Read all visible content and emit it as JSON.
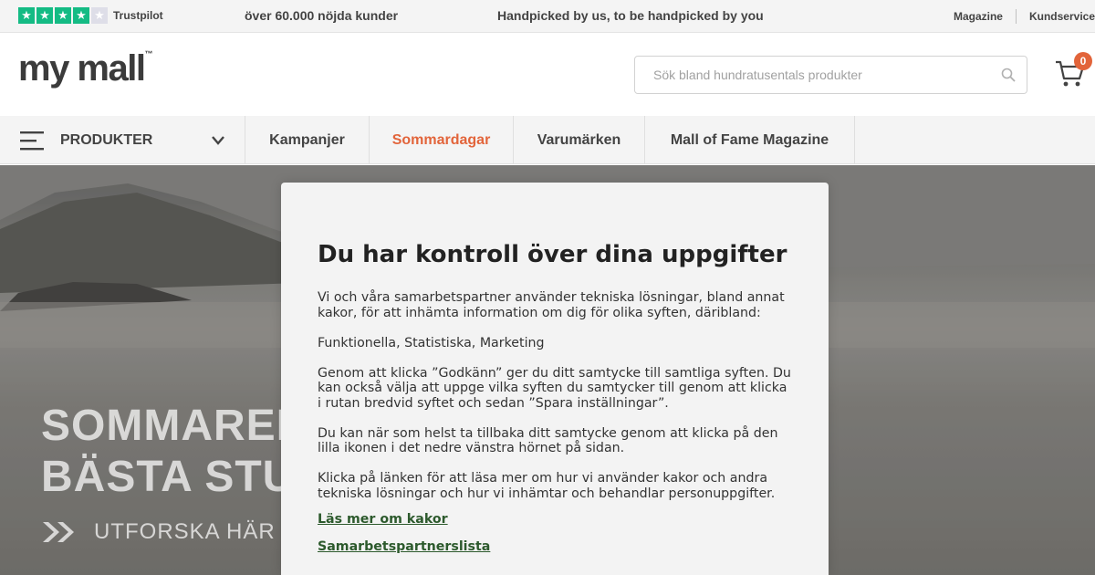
{
  "topbar": {
    "trustpilot_label": "Trustpilot",
    "trustpilot_stars": 4,
    "trustpilot_max": 5,
    "happy_customers": "över 60.000 nöjda kunder",
    "slogan": "Handpicked by us, to be handpicked by you",
    "links": [
      "Magazine",
      "Kundservice"
    ]
  },
  "header": {
    "logo": "my mall",
    "logo_tm": "™",
    "search_placeholder": "Sök bland hundratusentals produkter",
    "cart_count": "0"
  },
  "nav": {
    "products_label": "PRODUKTER",
    "items": [
      "Kampanjer",
      "Sommardagar",
      "Varumärken",
      "Mall of Fame Magazine"
    ],
    "highlight_color": "#e0572a"
  },
  "hero": {
    "title_line1": "SOMMAREN",
    "title_line2": "BÄSTA STU",
    "cta": "UTFORSKA HÄR"
  },
  "consent": {
    "title": "Du har kontroll över dina uppgifter",
    "p1": "Vi och våra samarbetspartner använder tekniska lösningar, bland annat kakor, för att inhämta information om dig för olika syften, däribland:",
    "p2": "Funktionella, Statistiska, Marketing",
    "p3": "Genom att klicka ”Godkänn” ger du ditt samtycke till samtliga syften. Du kan också välja att uppge vilka syften du samtycker till genom att klicka i rutan bredvid syftet och sedan ”Spara inställningar”.",
    "p4": "Du kan när som helst ta tillbaka ditt samtycke genom att klicka på den lilla ikonen i det nedre vänstra hörnet på sidan.",
    "p5": "Klicka på länken för att läsa mer om hur vi använder kakor och andra tekniska lösningar och hur vi inhämtar och behandlar personuppgifter.",
    "link_cookies": "Läs mer om kakor",
    "link_partial": "Samarbetspartnerslista"
  }
}
